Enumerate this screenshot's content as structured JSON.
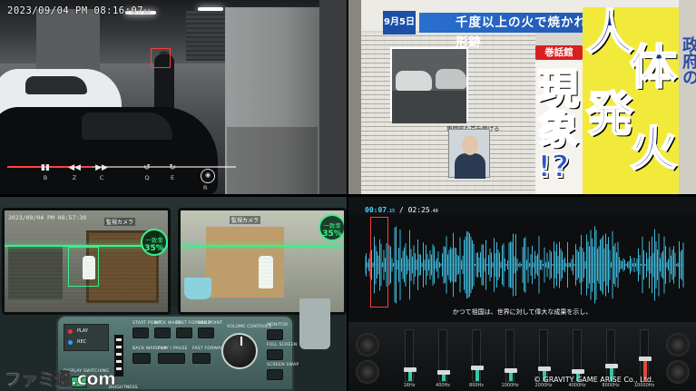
{
  "cctv": {
    "timestamp": "2023/09/04 PM 08:16:07",
    "timestamp_sub": "01",
    "controls": [
      {
        "icon": "pause-bars-icon",
        "glyph": "▮▮",
        "label": "B"
      },
      {
        "icon": "rewind-icon",
        "glyph": "◀◀",
        "label": "Z"
      },
      {
        "icon": "fast-forward-icon",
        "glyph": "▶▶",
        "label": "C"
      },
      {
        "icon": "loop-back-icon",
        "glyph": "↺",
        "label": "Q"
      },
      {
        "icon": "loop-forward-icon",
        "glyph": "↻",
        "label": "E"
      }
    ],
    "ring_label": "R",
    "progress": 0.37
  },
  "newspaper": {
    "date": "9月5日",
    "headline": "千度以上の火で焼かれた形跡",
    "magazine_tag": "巻話館",
    "big_title_chars": [
      "人",
      "体",
      "発",
      "火"
    ],
    "sub_title_chars": [
      "現",
      "象",
      "!?"
    ],
    "caption": "専門家も首を傾げる",
    "side_text": "政府の"
  },
  "panel": {
    "left_timestamp": "2023/09/04 PM 08:57:39",
    "badges": [
      {
        "title": "一致率",
        "value": "35%"
      },
      {
        "title": "一致率",
        "value": "35%"
      }
    ],
    "labels": [
      "監視カメラ",
      "監視カメラ"
    ],
    "console": {
      "top_buttons": [
        "START POINT",
        "BACK WARD",
        "FAST FORWARD",
        "END POINT"
      ],
      "mid_buttons": [
        "BACK WARD X4",
        "PLAY / PAUSE",
        "FAST FORWARD X4"
      ],
      "volume_label": "VOLUME CONTROLS",
      "right_buttons": [
        "MONITOR",
        "FULL SCREEN",
        "SCREEN SWAP"
      ],
      "left_panel_rows": [
        "PLAY",
        "REC"
      ],
      "bottom_left": "DISPLAY SWITCHING",
      "bottom_mid": "BRIGHTNESS"
    },
    "watermark": "ファミ通.com"
  },
  "audio": {
    "current_time": "00:07",
    "current_ms": ".15",
    "total_time": "02:25",
    "total_ms": ".40",
    "subtitle": "かつて祖国は、世界に対して偉大な成果を示し、",
    "bands": [
      "16Hz",
      "400Hz",
      "800Hz",
      "1000Hz",
      "2000Hz",
      "4000Hz",
      "8000Hz",
      "10000Hz"
    ],
    "fader_levels": [
      0.18,
      0.12,
      0.22,
      0.16,
      0.2,
      0.14,
      0.25,
      0.4
    ],
    "copyright": "© GRAVITY GAME ARISE Co., Ltd.",
    "accent": "#35c7a8",
    "wave_color": "#3fb9da"
  }
}
